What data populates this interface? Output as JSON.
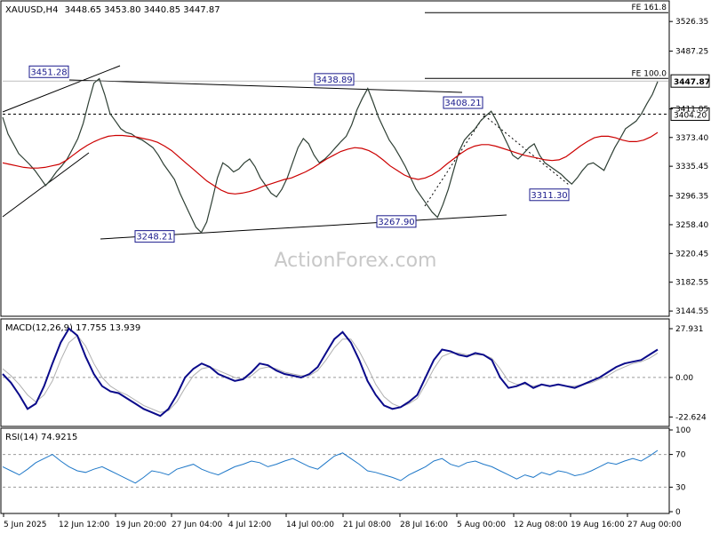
{
  "chart_data": {
    "type": "line",
    "symbol": "XAUUSD,H4",
    "ohlc_readout": "3448.65 3453.80 3440.85 3447.87",
    "watermark": "ActionForex.com",
    "price_panel": {
      "ylim": [
        3140,
        3550
      ],
      "y_ticks": [
        "3526.35",
        "3487.25",
        "3411.05",
        "3373.40",
        "3335.45",
        "3296.35",
        "3258.40",
        "3220.45",
        "3182.55",
        "3144.55"
      ],
      "y_tick_values": [
        3526.35,
        3487.25,
        3411.05,
        3373.4,
        3335.45,
        3296.35,
        3258.4,
        3220.45,
        3182.55,
        3144.55
      ],
      "price_series": [
        3400,
        3378,
        3365,
        3352,
        3345,
        3338,
        3330,
        3320,
        3310,
        3318,
        3328,
        3336,
        3345,
        3358,
        3372,
        3392,
        3420,
        3445,
        3451,
        3430,
        3405,
        3395,
        3385,
        3380,
        3378,
        3373,
        3370,
        3365,
        3360,
        3350,
        3338,
        3328,
        3318,
        3300,
        3285,
        3270,
        3255,
        3248,
        3262,
        3290,
        3320,
        3340,
        3335,
        3328,
        3332,
        3340,
        3345,
        3335,
        3320,
        3310,
        3300,
        3295,
        3305,
        3320,
        3340,
        3360,
        3372,
        3365,
        3350,
        3340,
        3345,
        3352,
        3360,
        3368,
        3375,
        3390,
        3410,
        3425,
        3438,
        3420,
        3400,
        3385,
        3370,
        3360,
        3348,
        3335,
        3320,
        3305,
        3295,
        3285,
        3275,
        3268,
        3285,
        3305,
        3330,
        3355,
        3370,
        3378,
        3385,
        3395,
        3402,
        3408,
        3395,
        3380,
        3365,
        3350,
        3345,
        3352,
        3360,
        3365,
        3350,
        3340,
        3335,
        3330,
        3325,
        3318,
        3312,
        3320,
        3330,
        3338,
        3340,
        3335,
        3330,
        3345,
        3360,
        3372,
        3385,
        3390,
        3395,
        3405,
        3418,
        3430,
        3447
      ],
      "ma_series": [
        3340,
        3338,
        3336,
        3334,
        3333,
        3333,
        3334,
        3336,
        3338,
        3343,
        3350,
        3357,
        3363,
        3368,
        3372,
        3375,
        3376,
        3376,
        3375,
        3374,
        3372,
        3370,
        3367,
        3362,
        3356,
        3348,
        3340,
        3332,
        3324,
        3316,
        3310,
        3304,
        3300,
        3299,
        3300,
        3302,
        3305,
        3309,
        3312,
        3315,
        3318,
        3320,
        3324,
        3328,
        3333,
        3339,
        3345,
        3350,
        3355,
        3358,
        3360,
        3359,
        3356,
        3351,
        3344,
        3336,
        3330,
        3324,
        3320,
        3318,
        3320,
        3324,
        3330,
        3338,
        3345,
        3352,
        3358,
        3362,
        3364,
        3364,
        3362,
        3359,
        3356,
        3353,
        3350,
        3348,
        3346,
        3344,
        3343,
        3344,
        3348,
        3355,
        3362,
        3368,
        3373,
        3375,
        3375,
        3373,
        3370,
        3368,
        3368,
        3370,
        3374,
        3380
      ],
      "ma_color": "#cc0000",
      "price_color": "#2e3f34",
      "annotations": [
        {
          "label": "3451.28",
          "value": 3451.28
        },
        {
          "label": "3438.89",
          "value": 3438.89
        },
        {
          "label": "3408.21",
          "value": 3408.21
        },
        {
          "label": "3248.21",
          "value": 3248.21
        },
        {
          "label": "3267.90",
          "value": 3267.9
        },
        {
          "label": "3311.30",
          "value": 3311.3
        }
      ],
      "levels": [
        {
          "label": "FE 161.8",
          "value": 3538
        },
        {
          "label": "FE 100.0",
          "value": 3451.28
        }
      ],
      "current_price": {
        "label": "3447.87",
        "value": 3447.87
      },
      "dotted_level": {
        "label": "3404.20",
        "value": 3404.2
      }
    },
    "macd_panel": {
      "title": "MACD(12,26,9) 17.755 13.939",
      "ylim": [
        -27,
        32
      ],
      "y_ticks": [
        "27.931",
        "0.00",
        "-22.624"
      ],
      "y_tick_values": [
        27.931,
        0,
        -22.624
      ],
      "main_series": [
        2,
        -3,
        -10,
        -18,
        -15,
        -5,
        8,
        20,
        28,
        24,
        12,
        2,
        -5,
        -8,
        -9,
        -12,
        -15,
        -18,
        -20,
        -22,
        -18,
        -10,
        0,
        5,
        8,
        6,
        2,
        0,
        -2,
        -1,
        3,
        8,
        7,
        4,
        2,
        1,
        0,
        2,
        6,
        14,
        22,
        26,
        20,
        10,
        -2,
        -10,
        -16,
        -18,
        -17,
        -14,
        -10,
        0,
        10,
        16,
        15,
        13,
        12,
        14,
        13,
        10,
        0,
        -6,
        -5,
        -3,
        -6,
        -4,
        -5,
        -4,
        -5,
        -6,
        -4,
        -2,
        0,
        3,
        6,
        8,
        9,
        10,
        13,
        16
      ],
      "signal_series": [
        5,
        1,
        -4,
        -10,
        -14,
        -10,
        -2,
        10,
        20,
        24,
        18,
        8,
        0,
        -5,
        -8,
        -10,
        -13,
        -16,
        -18,
        -20,
        -19,
        -14,
        -6,
        1,
        5,
        6,
        4,
        2,
        0,
        -1,
        1,
        5,
        6,
        5,
        3,
        2,
        1,
        1,
        4,
        10,
        17,
        22,
        22,
        15,
        6,
        -4,
        -11,
        -15,
        -17,
        -15,
        -12,
        -4,
        5,
        12,
        14,
        14,
        13,
        13,
        13,
        11,
        5,
        -2,
        -4,
        -4,
        -5,
        -4,
        -5,
        -4,
        -5,
        -5,
        -4,
        -3,
        -1,
        1,
        4,
        6,
        8,
        9,
        11,
        14
      ],
      "main_color": "#0a0a8a",
      "signal_color": "#b0b0b0"
    },
    "rsi_panel": {
      "title": "RSI(14) 74.9215",
      "ylim": [
        0,
        100
      ],
      "y_ticks": [
        "100",
        "70",
        "30",
        "0"
      ],
      "y_tick_values": [
        100,
        70,
        30,
        0
      ],
      "series": [
        55,
        50,
        45,
        52,
        60,
        65,
        70,
        62,
        55,
        50,
        48,
        52,
        55,
        50,
        45,
        40,
        35,
        42,
        50,
        48,
        45,
        52,
        55,
        58,
        52,
        48,
        45,
        50,
        55,
        58,
        62,
        60,
        55,
        58,
        62,
        65,
        60,
        55,
        52,
        60,
        68,
        72,
        65,
        58,
        50,
        48,
        45,
        42,
        38,
        45,
        50,
        55,
        62,
        65,
        58,
        55,
        60,
        62,
        58,
        55,
        50,
        45,
        40,
        45,
        42,
        48,
        45,
        50,
        48,
        44,
        46,
        50,
        55,
        60,
        58,
        62,
        65,
        62,
        68,
        75
      ],
      "color": "#1f78c8"
    },
    "x_ticks": [
      "5 Jun 2025",
      "12 Jun 12:00",
      "19 Jun 20:00",
      "27 Jun 04:00",
      "4 Jul 12:00",
      "14 Jul 00:00",
      "21 Jul 08:00",
      "28 Jul 16:00",
      "5 Aug 00:00",
      "12 Aug 08:00",
      "19 Aug 16:00",
      "27 Aug 00:00"
    ]
  }
}
